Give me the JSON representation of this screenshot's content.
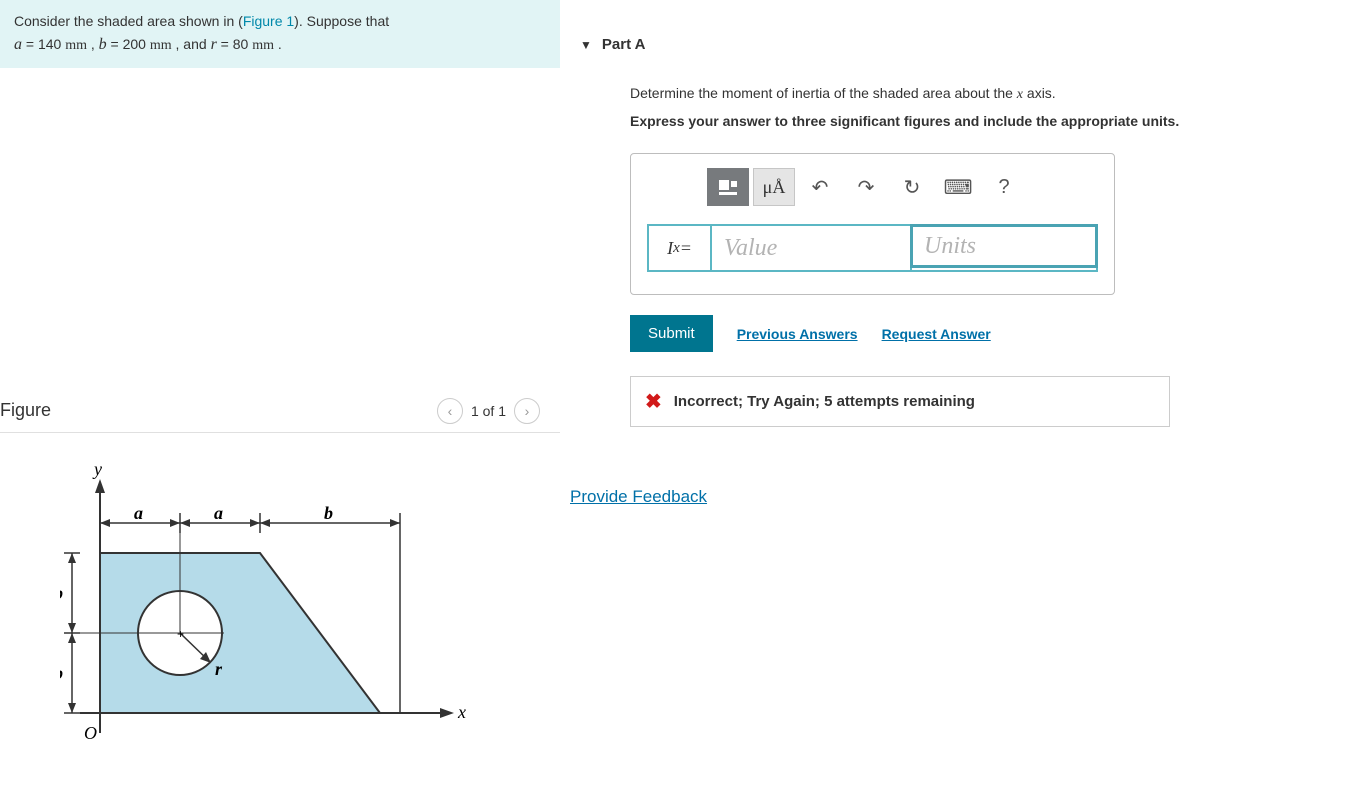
{
  "problem": {
    "pre": "Consider the shaded area shown in (",
    "figlink": "Figure 1",
    "post": "). Suppose that ",
    "line2_a_var": "a",
    "line2_a_eq": " = 140 ",
    "line2_a_unit": "mm",
    "line2_sep1": " , ",
    "line2_b_var": "b",
    "line2_b_eq": " = 200 ",
    "line2_b_unit": "mm",
    "line2_sep2": " , and ",
    "line2_r_var": "r",
    "line2_r_eq": " = 80 ",
    "line2_r_unit": "mm",
    "line2_end": " ."
  },
  "figure": {
    "title": "Figure",
    "pager": "1 of 1",
    "labels": {
      "y": "y",
      "x": "x",
      "a": "a",
      "b": "b",
      "r": "r",
      "O": "O"
    }
  },
  "part": {
    "label": "Part A",
    "instruction_pre": "Determine the moment of inertia of the shaded area about the ",
    "instruction_var": "x",
    "instruction_post": " axis.",
    "express": "Express your answer to three significant figures and include the appropriate units.",
    "lhs_html": "I",
    "lhs_sub": "x",
    "lhs_eq": " =",
    "value_placeholder": "Value",
    "units_placeholder": "Units",
    "submit": "Submit",
    "prev_answers": "Previous Answers",
    "request_answer": "Request Answer",
    "mu_label": "μÅ",
    "help": "?"
  },
  "feedback": {
    "message": "Incorrect; Try Again; 5 attempts remaining"
  },
  "provide_feedback": "Provide Feedback"
}
